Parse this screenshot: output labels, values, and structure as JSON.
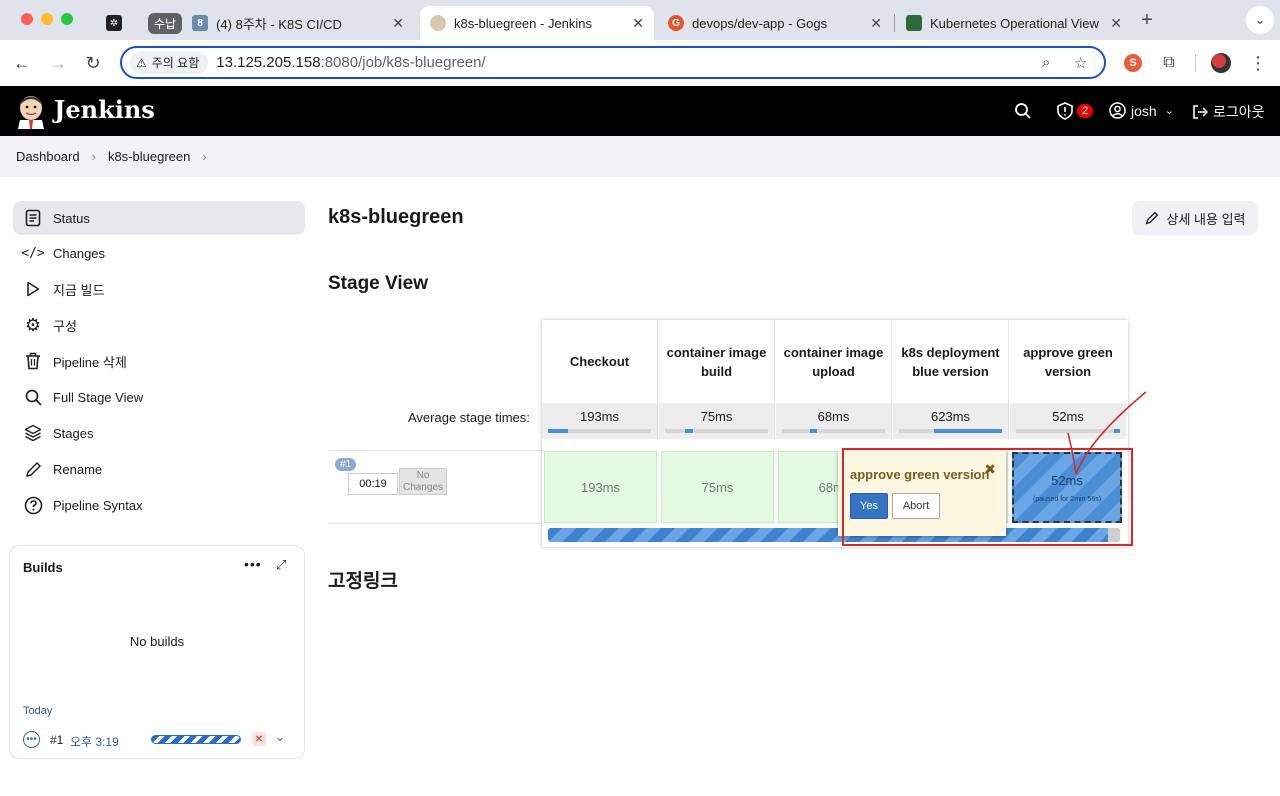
{
  "browser": {
    "tabs": [
      {
        "label": "",
        "favicon": "jenkins-ascii-icon"
      },
      {
        "label": "(4) 8주차 - K8S CI/CD",
        "group": "수납",
        "favicon_text": "8"
      },
      {
        "label": "k8s-bluegreen - Jenkins",
        "active": true
      },
      {
        "label": "devops/dev-app - Gogs"
      },
      {
        "label": "Kubernetes Operational View"
      }
    ],
    "security_label": "주의 요함",
    "url_host": "13.125.205.158",
    "url_path": ":8080/job/k8s-bluegreen/"
  },
  "header": {
    "brand": "Jenkins",
    "alerts_count": "2",
    "user": "josh",
    "logout": "로그아웃"
  },
  "breadcrumb": [
    "Dashboard",
    "k8s-bluegreen"
  ],
  "sidebar": {
    "items": [
      {
        "label": "Status",
        "icon": "status-icon"
      },
      {
        "label": "Changes",
        "icon": "code-icon"
      },
      {
        "label": "지금 빌드",
        "icon": "play-icon"
      },
      {
        "label": "구성",
        "icon": "gear-icon"
      },
      {
        "label": "Pipeline 삭제",
        "icon": "trash-icon"
      },
      {
        "label": "Full Stage View",
        "icon": "search-icon"
      },
      {
        "label": "Stages",
        "icon": "layers-icon"
      },
      {
        "label": "Rename",
        "icon": "pencil-icon"
      },
      {
        "label": "Pipeline Syntax",
        "icon": "help-icon"
      }
    ]
  },
  "builds": {
    "title": "Builds",
    "empty": "No builds",
    "group": "Today",
    "entry": {
      "number": "#1",
      "time": "오후 3:19"
    }
  },
  "main": {
    "title": "k8s-bluegreen",
    "edit_label": "상세 내용 입력",
    "stage_view_title": "Stage View",
    "permalinks_title": "고정링크"
  },
  "stage_view": {
    "avg_label": "Average stage times:",
    "stages": [
      {
        "name": "Checkout",
        "avg": "193ms",
        "avg_fraction": 0.19,
        "cell": "193ms"
      },
      {
        "name": "container image build",
        "avg": "75ms",
        "avg_fraction": 0.08,
        "cell": "75ms"
      },
      {
        "name": "container image upload",
        "avg": "68ms",
        "avg_fraction": 0.07,
        "cell": "68ms"
      },
      {
        "name": "k8s deployment blue version",
        "avg": "623ms",
        "avg_fraction": 0.65,
        "cell": ""
      },
      {
        "name": "approve green version",
        "avg": "52ms",
        "avg_fraction": 0.05,
        "cell": "52ms"
      }
    ],
    "run": {
      "badge": "#1",
      "duration": "00:19",
      "changes": "No Changes"
    },
    "paused_value": "52ms",
    "paused_note": "(paused for 2min 56s)",
    "progress_fraction": 0.97
  },
  "approval_popup": {
    "title": "approve green version",
    "yes": "Yes",
    "abort": "Abort"
  }
}
